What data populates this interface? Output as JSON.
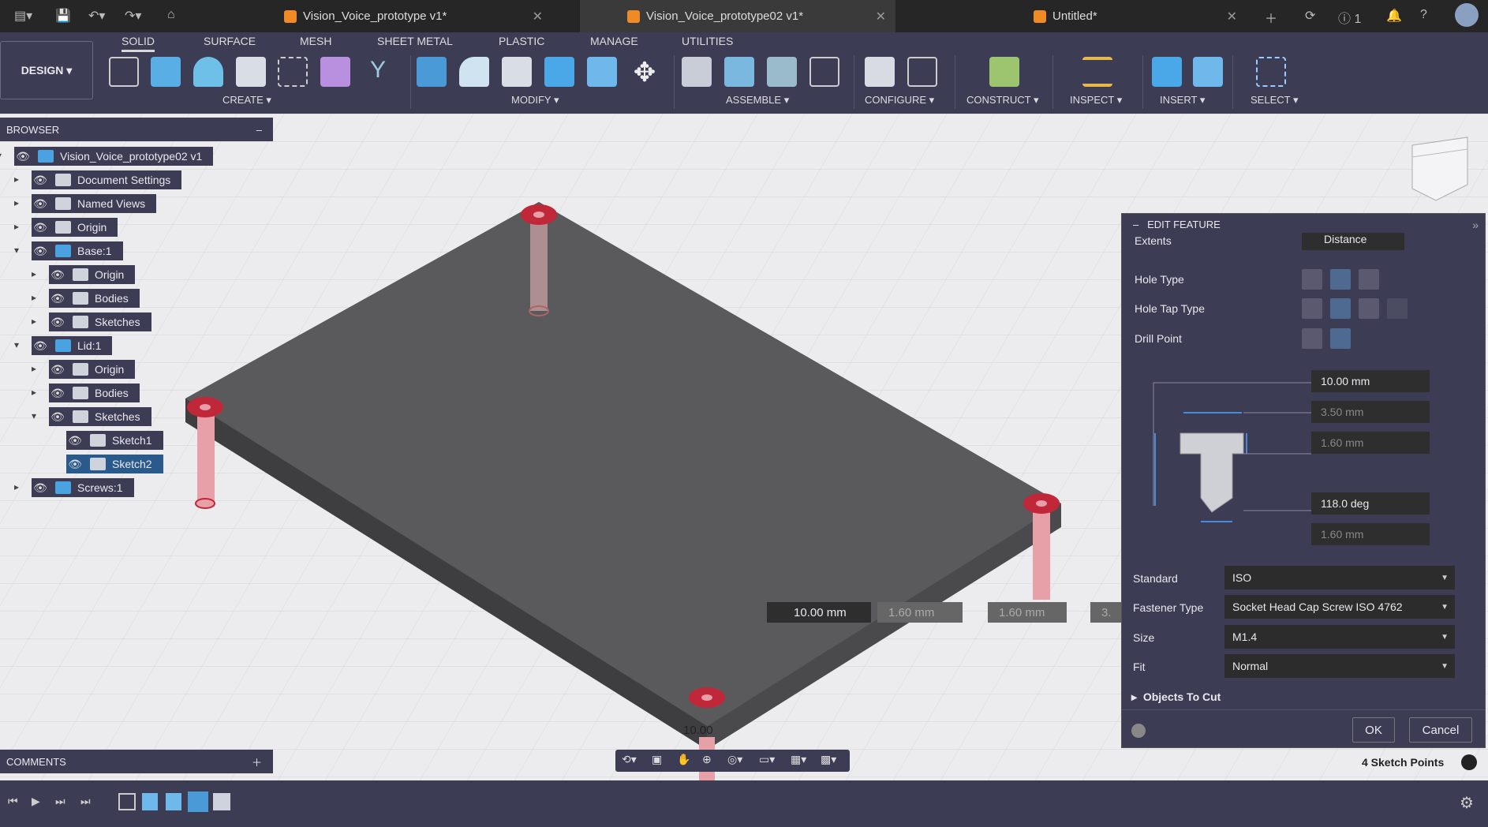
{
  "tabs": [
    {
      "label": "Vision_Voice_prototype v1*",
      "active": false
    },
    {
      "label": "Vision_Voice_prototype02 v1*",
      "active": true
    },
    {
      "label": "Untitled*",
      "active": false
    }
  ],
  "header_right": {
    "notifications": "1"
  },
  "workspace": "DESIGN",
  "ribbon_tabs": [
    "SOLID",
    "SURFACE",
    "MESH",
    "SHEET METAL",
    "PLASTIC",
    "MANAGE",
    "UTILITIES"
  ],
  "active_ribbon_tab": "SOLID",
  "groups": [
    "CREATE",
    "MODIFY",
    "ASSEMBLE",
    "CONFIGURE",
    "CONSTRUCT",
    "INSPECT",
    "INSERT",
    "SELECT"
  ],
  "browser": {
    "title": "BROWSER",
    "items": [
      {
        "label": "Vision_Voice_prototype02 v1",
        "level": 0
      },
      {
        "label": "Document Settings",
        "level": 1
      },
      {
        "label": "Named Views",
        "level": 1
      },
      {
        "label": "Origin",
        "level": 1
      },
      {
        "label": "Base:1",
        "level": 1
      },
      {
        "label": "Origin",
        "level": 2
      },
      {
        "label": "Bodies",
        "level": 2
      },
      {
        "label": "Sketches",
        "level": 2
      },
      {
        "label": "Lid:1",
        "level": 1
      },
      {
        "label": "Origin",
        "level": 2
      },
      {
        "label": "Bodies",
        "level": 2
      },
      {
        "label": "Sketches",
        "level": 2
      },
      {
        "label": "Sketch1",
        "level": 3
      },
      {
        "label": "Sketch2",
        "level": 3,
        "selected": true
      },
      {
        "label": "Screws:1",
        "level": 1
      }
    ]
  },
  "comments": {
    "title": "COMMENTS"
  },
  "viewport": {
    "dims": [
      "10.00 mm",
      "1.60 mm",
      "1.60 mm",
      "3."
    ],
    "plate_label": "10.00",
    "plate_color": "#5a5a5c",
    "hole_color": "#c0283a"
  },
  "edit_feature": {
    "title": "EDIT FEATURE",
    "extents_label": "Extents",
    "extents_value": "Distance",
    "hole_type_label": "Hole Type",
    "hole_tap_type_label": "Hole Tap Type",
    "drill_point_label": "Drill Point",
    "dims": [
      "10.00 mm",
      "3.50 mm",
      "1.60 mm",
      "118.0 deg",
      "1.60 mm"
    ],
    "standard_label": "Standard",
    "standard": "ISO",
    "fastener_label": "Fastener Type",
    "fastener": "Socket Head Cap Screw ISO 4762",
    "size_label": "Size",
    "size": "M1.4",
    "fit_label": "Fit",
    "fit": "Normal",
    "objects_to_cut": "Objects To Cut",
    "ok": "OK",
    "cancel": "Cancel"
  },
  "status": "4 Sketch Points"
}
